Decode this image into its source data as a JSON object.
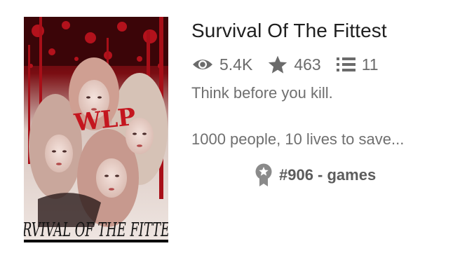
{
  "story": {
    "title": "Survival Of The Fittest",
    "cover": {
      "image_alt": "book-cover",
      "overlay_text": "WLP",
      "banner_text": "RVIVAL OF THE FITTE"
    },
    "stats": {
      "reads": "5.4K",
      "votes": "463",
      "parts": "11"
    },
    "tagline": "Think before you kill.",
    "description": "1000 people, 10 lives to save...",
    "ranking": "#906 - games"
  },
  "colors": {
    "title": "#1f1f1f",
    "text_muted": "#6f6f6f",
    "icon": "#6b6b6b",
    "rank_badge": "#8a8a8a",
    "cover_blood": "#b3121c"
  },
  "icons": {
    "reads": "eye-icon",
    "votes": "star-icon",
    "parts": "list-icon",
    "ranking": "ribbon-badge-icon"
  }
}
